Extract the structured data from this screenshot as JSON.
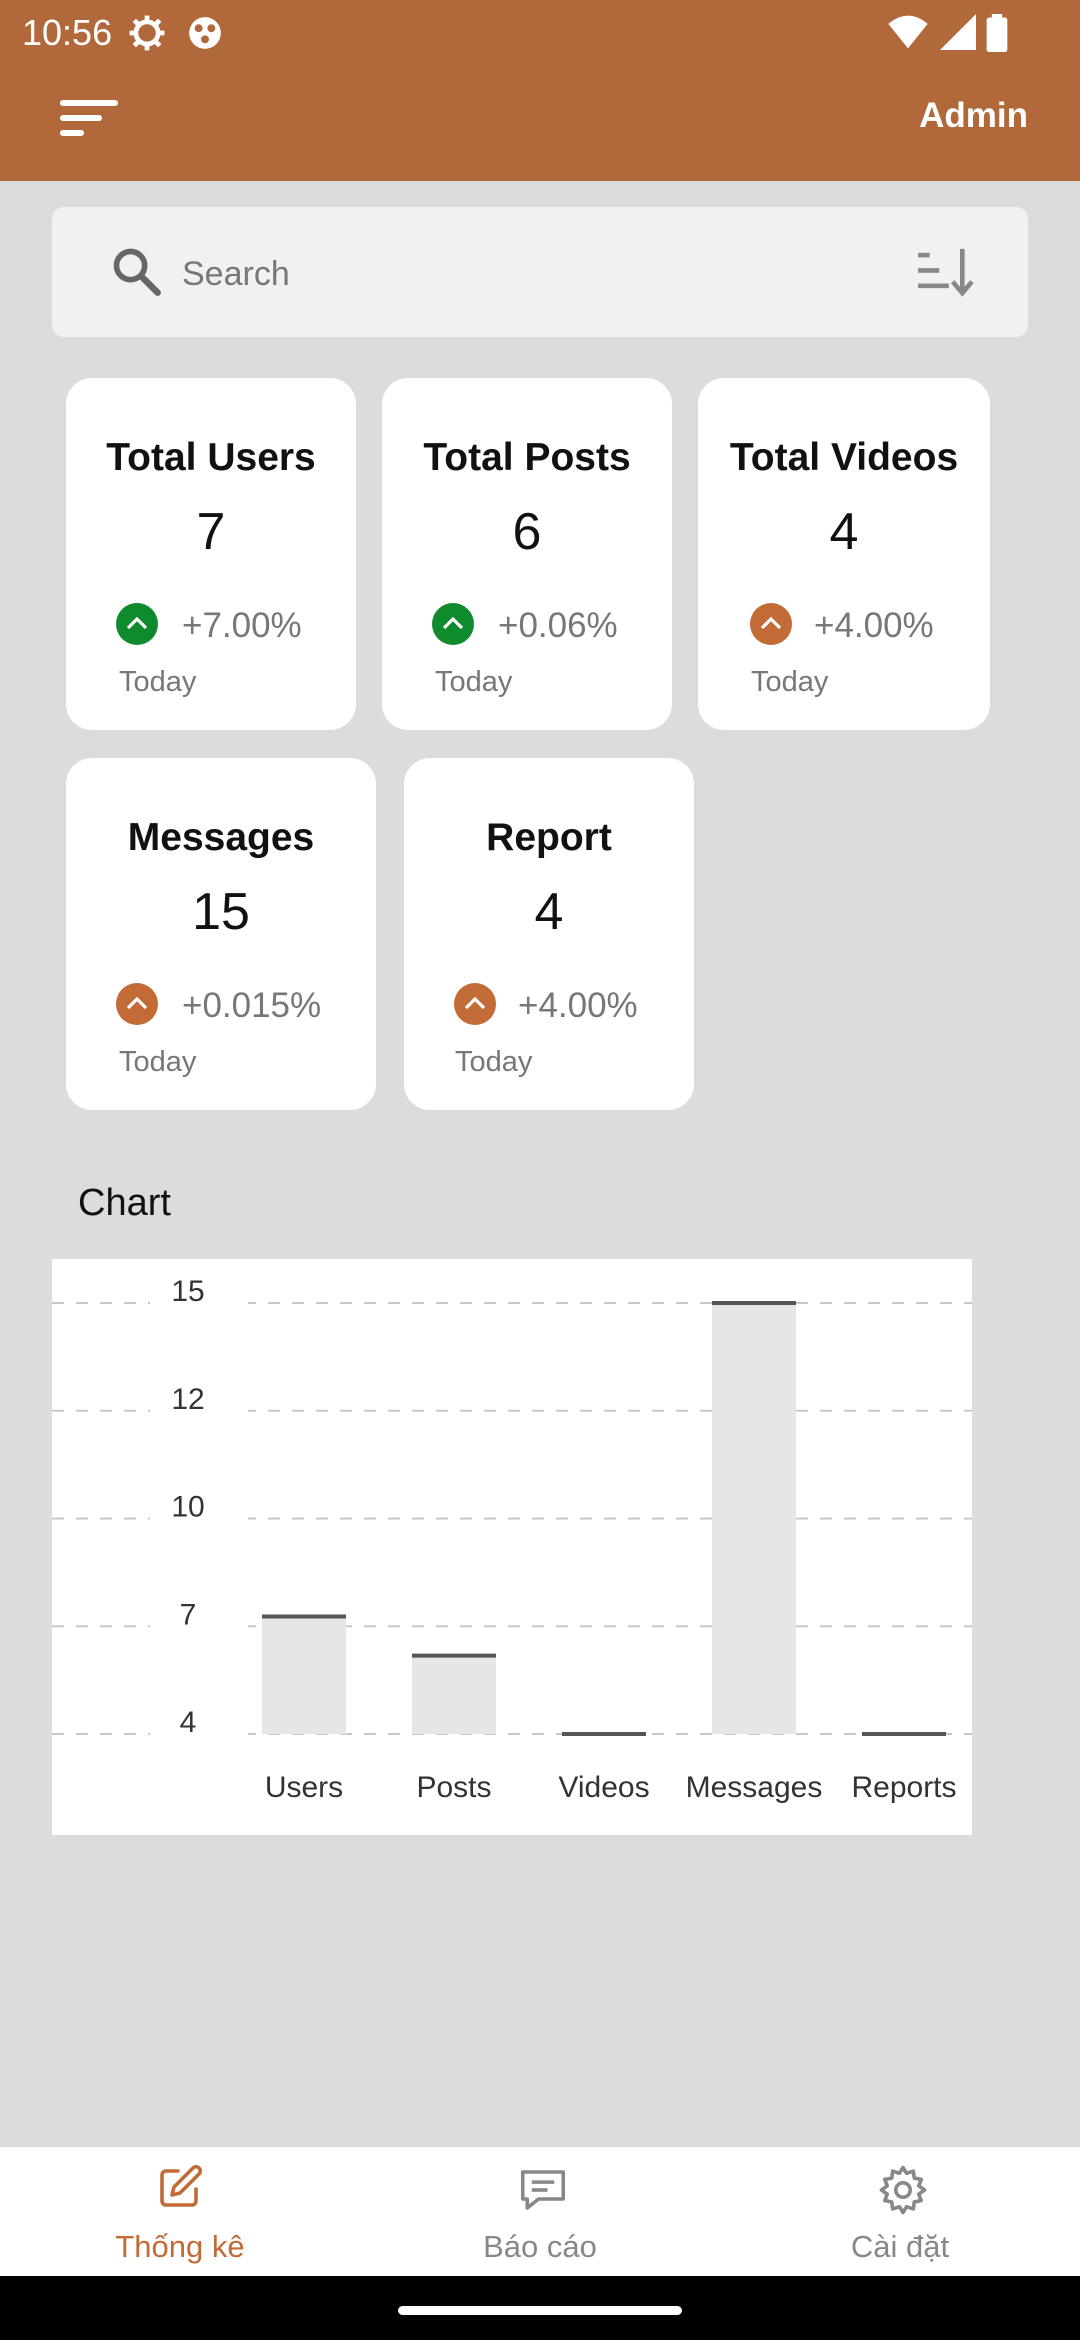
{
  "status": {
    "time": "10:56"
  },
  "appbar": {
    "title": "Admin"
  },
  "search": {
    "placeholder": "Search"
  },
  "cards": [
    {
      "title": "Total Users",
      "value": "7",
      "pct": "+7.00%",
      "period": "Today",
      "trend_color": "#0f8a2d"
    },
    {
      "title": "Total Posts",
      "value": "6",
      "pct": "+0.06%",
      "period": "Today",
      "trend_color": "#0f8a2d"
    },
    {
      "title": "Total Videos",
      "value": "4",
      "pct": "+4.00%",
      "period": "Today",
      "trend_color": "#c26b36"
    },
    {
      "title": "Messages",
      "value": "15",
      "pct": "+0.015%",
      "period": "Today",
      "trend_color": "#c26b36"
    },
    {
      "title": "Report",
      "value": "4",
      "pct": "+4.00%",
      "period": "Today",
      "trend_color": "#c26b36"
    }
  ],
  "chart": {
    "title": "Chart"
  },
  "chart_data": {
    "type": "bar",
    "categories": [
      "Users",
      "Posts",
      "Videos",
      "Messages",
      "Reports"
    ],
    "values": [
      7,
      6,
      4,
      15,
      4
    ],
    "yticks": [
      "4",
      "7",
      "10",
      "12",
      "15"
    ],
    "ylim": [
      4,
      15
    ],
    "grid": true,
    "bar_color": "#e6e6e6",
    "cap_color": "#555555"
  },
  "nav": {
    "items": [
      {
        "label": "Thống kê",
        "icon": "edit-icon"
      },
      {
        "label": "Báo cáo",
        "icon": "message-icon"
      },
      {
        "label": "Cài đặt",
        "icon": "gear-icon"
      }
    ]
  },
  "colors": {
    "primary": "#b1693b",
    "accent": "#c26b36",
    "background": "#dcdcdc"
  }
}
